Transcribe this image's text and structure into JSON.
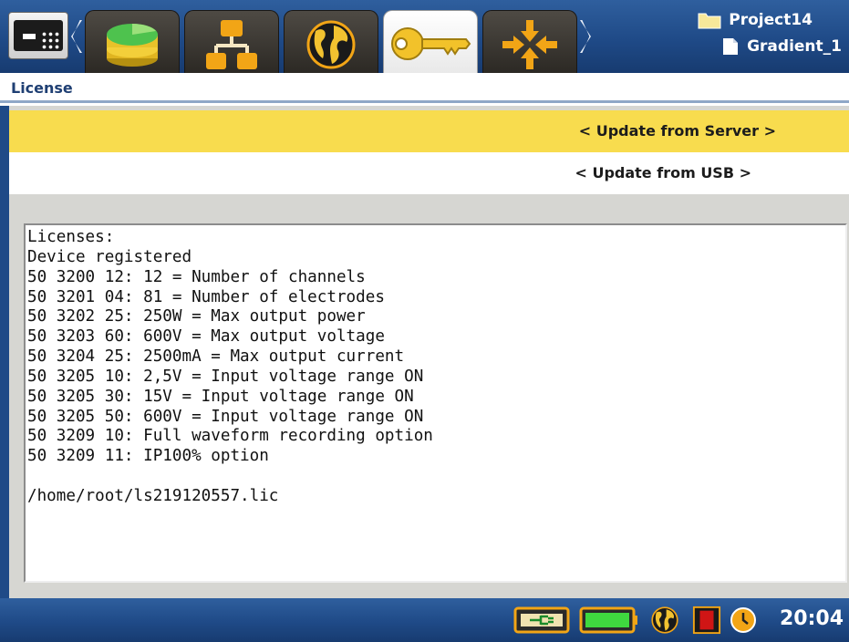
{
  "toolbar": {
    "tabs": [
      {
        "name": "menu",
        "icon": "menu-icon"
      },
      {
        "name": "database",
        "icon": "database-icon"
      },
      {
        "name": "network",
        "icon": "network-icon"
      },
      {
        "name": "globe",
        "icon": "globe-icon"
      },
      {
        "name": "license",
        "icon": "key-icon",
        "active": true
      },
      {
        "name": "position",
        "icon": "arrows-in-icon"
      }
    ],
    "project_name": "Project14",
    "file_name": "Gradient_1"
  },
  "page": {
    "title": "License"
  },
  "actions": {
    "update_server": "< Update from Server >",
    "update_usb": "< Update from USB >"
  },
  "license_text": "Licenses:\nDevice registered\n50 3200 12: 12 = Number of channels\n50 3201 04: 81 = Number of electrodes\n50 3202 25: 250W = Max output power\n50 3203 60: 600V = Max output voltage\n50 3204 25: 2500mA = Max output current\n50 3205 10: 2,5V = Input voltage range ON\n50 3205 30: 15V = Input voltage range ON\n50 3205 50: 600V = Input voltage range ON\n50 3209 10: Full waveform recording option\n50 3209 11: IP100% option\n\n/home/root/ls219120557.lic",
  "status": {
    "time": "20:04",
    "icons": [
      "power-plug-icon",
      "battery-icon",
      "globe-icon",
      "record-indicator-icon",
      "clock-icon"
    ]
  },
  "colors": {
    "bar_blue": "#1f4a87",
    "highlight_yellow": "#f8dc4e"
  }
}
